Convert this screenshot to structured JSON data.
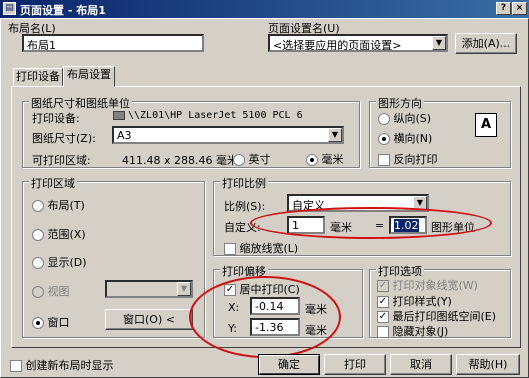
{
  "window": {
    "title": "页面设置 - 布局1"
  },
  "layout_name": {
    "label": "布局名(L)",
    "value": "布局1"
  },
  "page_setup_name": {
    "label": "页面设置名(U)",
    "value": "<选择要应用的页面设置>",
    "add_button": "添加(A)..."
  },
  "tabs": [
    {
      "label": "打印设备"
    },
    {
      "label": "布局设置"
    }
  ],
  "paper": {
    "group_title": "图纸尺寸和图纸单位",
    "device_label": "打印设备:",
    "device_value": "\\\\ZL01\\HP LaserJet 5100 PCL 6",
    "size_label": "图纸尺寸(Z):",
    "size_value": "A3",
    "area_label": "可打印区域:",
    "area_value": "411.48 x 288.46 毫米",
    "inch_label": "英寸",
    "mm_label": "毫米"
  },
  "orientation": {
    "group_title": "图形方向",
    "portrait": "纵向(S)",
    "landscape": "横向(N)",
    "reverse": "反向打印",
    "icon_letter": "A"
  },
  "print_area": {
    "group_title": "打印区域",
    "layout": "布局(T)",
    "extents": "范围(X)",
    "display": "显示(D)",
    "view": "视图",
    "window": "窗口",
    "window_button": "窗口(O) <"
  },
  "scale": {
    "group_title": "打印比例",
    "scale_label": "比例(S):",
    "scale_value": "自定义",
    "custom_label": "自定义:",
    "mm_value": "1",
    "mm_unit": "毫米",
    "equals": "=",
    "units_value": "1.02",
    "units_label": "图形单位",
    "lineweights": "缩放线宽(L)"
  },
  "offset": {
    "group_title": "打印偏移",
    "center": "居中打印(C)",
    "x_label": "X:",
    "x_value": "-0.14",
    "y_label": "Y:",
    "y_value": "-1.36",
    "unit": "毫米"
  },
  "options": {
    "group_title": "打印选项",
    "lineweights": "打印对象线宽(W)",
    "styles": "打印样式(Y)",
    "paperspace_last": "最后打印图纸空间(E)",
    "hide": "隐藏对象(J)"
  },
  "footer": {
    "show_on_new": "创建新布局时显示",
    "ok": "确定",
    "print": "打印",
    "cancel": "取消",
    "help": "帮助(H)"
  },
  "colors": {
    "title_start": "#0a246a",
    "title_end": "#3a6ea5",
    "annotation": "#d01010",
    "face": "#d4d0c8"
  }
}
